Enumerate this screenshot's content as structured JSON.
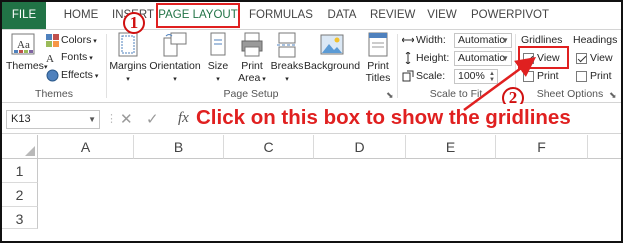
{
  "tabs": {
    "file": "FILE",
    "home": "HOME",
    "insert": "INSERT",
    "page_layout": "PAGE LAYOUT",
    "formulas": "FORMULAS",
    "data": "DATA",
    "review": "REVIEW",
    "view": "VIEW",
    "powerpivot": "POWERPIVOT"
  },
  "themes_group": {
    "themes_label": "Themes",
    "colors_label": "Colors",
    "fonts_label": "Fonts",
    "effects_label": "Effects",
    "group_label": "Themes"
  },
  "page_setup_group": {
    "margins_label": "Margins",
    "orientation_label": "Orientation",
    "size_label": "Size",
    "print_area_label_1": "Print",
    "print_area_label_2": "Area",
    "breaks_label": "Breaks",
    "background_label": "Background",
    "print_titles_label_1": "Print",
    "print_titles_label_2": "Titles",
    "group_label": "Page Setup"
  },
  "scale_group": {
    "width_label": "Width:",
    "width_value": "Automatic",
    "height_label": "Height:",
    "height_value": "Automatic",
    "scale_label": "Scale:",
    "scale_value": "100%",
    "group_label": "Scale to Fit"
  },
  "sheet_options_group": {
    "gridlines_header": "Gridlines",
    "gridlines_view_label": "View",
    "gridlines_view_checked": true,
    "gridlines_print_label": "Print",
    "headings_header": "Headings",
    "headings_view_label": "View",
    "headings_view_checked": true,
    "headings_print_label": "Print",
    "group_label": "Sheet Options"
  },
  "formula_bar": {
    "name_box_value": "K13",
    "fx_label": "fx"
  },
  "annotation": {
    "step1": "1",
    "step2": "2",
    "instruction_text": "Click on this box to show the gridlines"
  },
  "grid": {
    "columns": [
      "A",
      "B",
      "C",
      "D",
      "E",
      "F"
    ],
    "rows": [
      "1",
      "2",
      "3"
    ]
  },
  "colors": {
    "file_tab_bg": "#217346",
    "active_tab_text": "#217346",
    "annotation_red": "#e02020"
  }
}
